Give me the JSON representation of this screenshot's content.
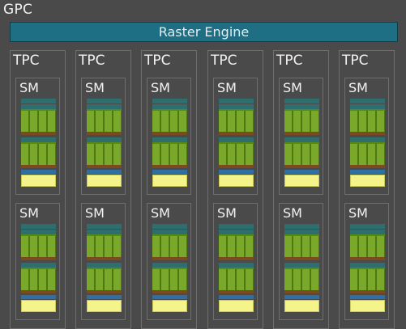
{
  "gpc": {
    "label": "GPC",
    "raster_engine": "Raster Engine",
    "tpcs": [
      {
        "label": "TPC",
        "sms": [
          {
            "label": "SM"
          },
          {
            "label": "SM"
          }
        ]
      },
      {
        "label": "TPC",
        "sms": [
          {
            "label": "SM"
          },
          {
            "label": "SM"
          }
        ]
      },
      {
        "label": "TPC",
        "sms": [
          {
            "label": "SM"
          },
          {
            "label": "SM"
          }
        ]
      },
      {
        "label": "TPC",
        "sms": [
          {
            "label": "SM"
          },
          {
            "label": "SM"
          }
        ]
      },
      {
        "label": "TPC",
        "sms": [
          {
            "label": "SM"
          },
          {
            "label": "SM"
          }
        ]
      },
      {
        "label": "TPC",
        "sms": [
          {
            "label": "SM"
          },
          {
            "label": "SM"
          }
        ]
      }
    ]
  },
  "colors": {
    "background": "#4a4a4a",
    "raster_engine": "#1e6f84",
    "cores": "#79a82a",
    "cache": "#f4f48a",
    "register": "#7b4a1f",
    "scheduler": "#2e6e6f"
  }
}
